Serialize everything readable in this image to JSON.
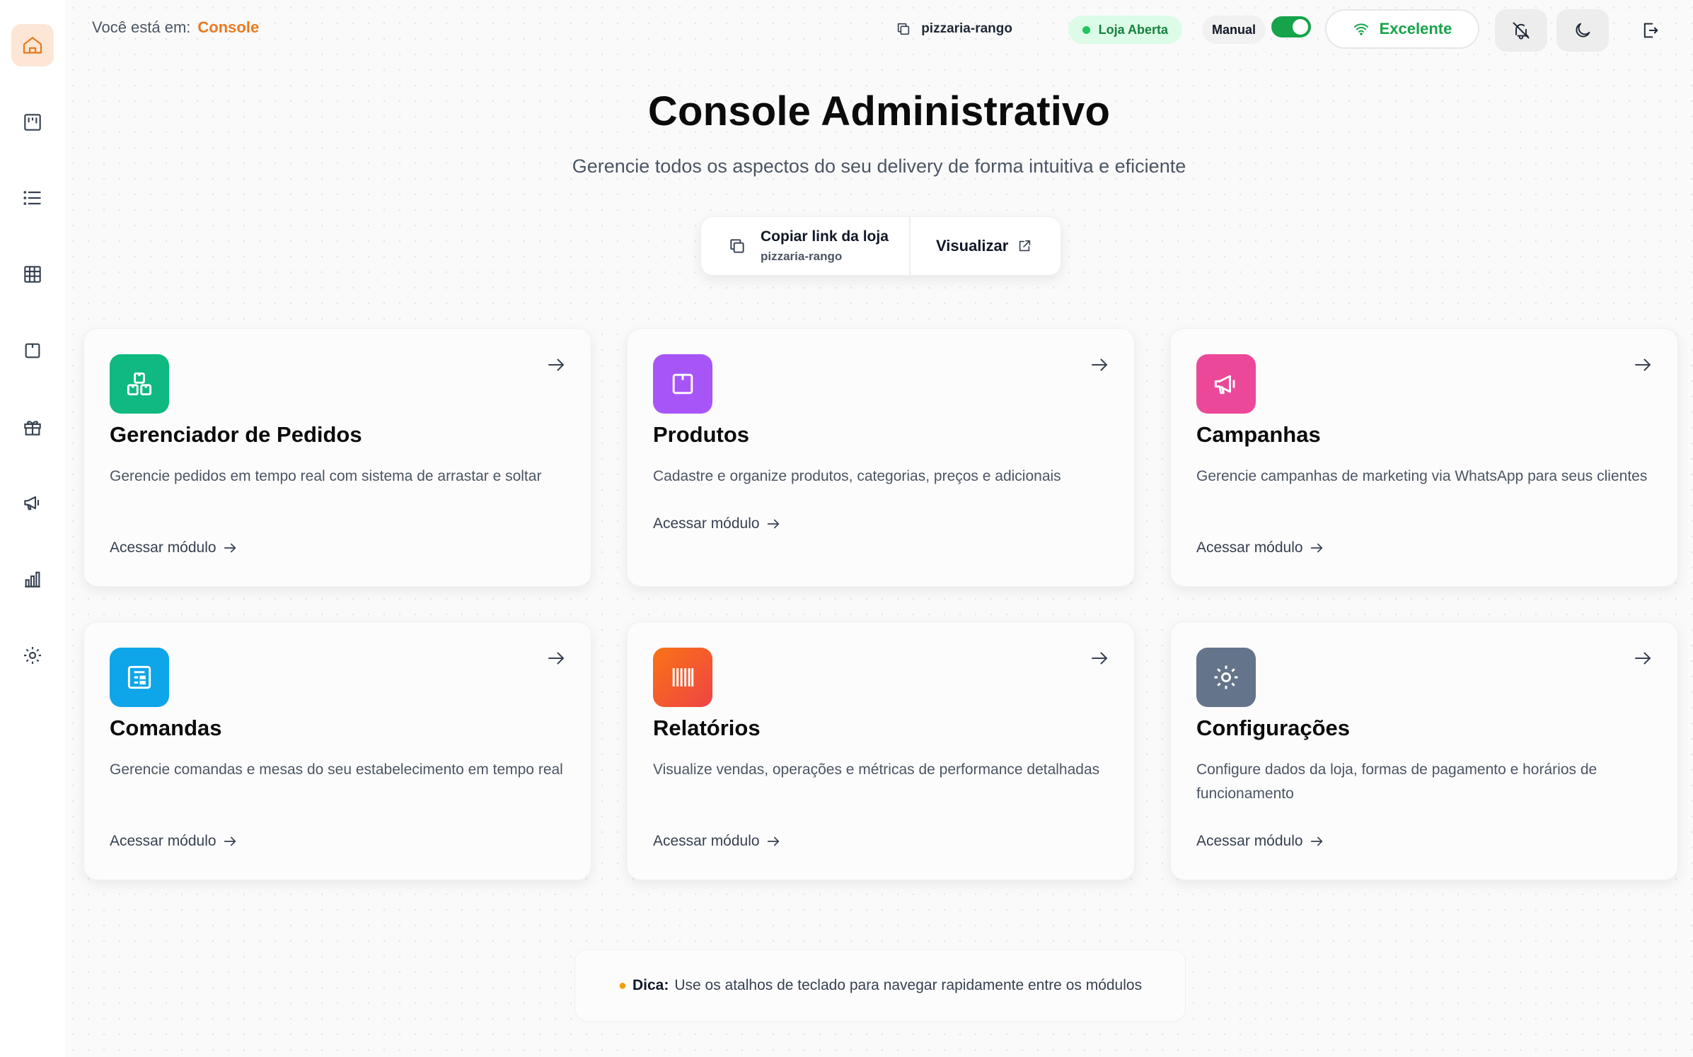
{
  "breadcrumb": {
    "prefix": "Você está em:",
    "current": "Console"
  },
  "topbar": {
    "store_slug": "pizzaria-rango",
    "status": "Loja Aberta",
    "mode": "Manual",
    "toggle_on": true,
    "connection": "Excelente"
  },
  "hero": {
    "title": "Console Administrativo",
    "subtitle": "Gerencie todos os aspectos do seu delivery de forma intuitiva e eficiente"
  },
  "copy_card": {
    "label": "Copiar link da loja",
    "slug": "pizzaria-rango",
    "view_label": "Visualizar"
  },
  "modules": [
    {
      "title": "Gerenciador de Pedidos",
      "description": "Gerencie pedidos em tempo real com sistema de arrastar e soltar",
      "link": "Acessar módulo",
      "color": "#10b981",
      "icon": "boxes-icon"
    },
    {
      "title": "Produtos",
      "description": "Cadastre e organize produtos, categorias, preços e adicionais",
      "link": "Acessar módulo",
      "color": "#a855f7",
      "icon": "package-icon"
    },
    {
      "title": "Campanhas",
      "description": "Gerencie campanhas de marketing via WhatsApp para seus clientes",
      "link": "Acessar módulo",
      "color": "#ec4899",
      "icon": "megaphone-icon"
    },
    {
      "title": "Comandas",
      "description": "Gerencie comandas e mesas do seu estabelecimento em tempo real",
      "link": "Acessar módulo",
      "color": "#0ea5e9",
      "icon": "receipt-icon"
    },
    {
      "title": "Relatórios",
      "description": "Visualize vendas, operações e métricas de performance detalhadas",
      "link": "Acessar módulo",
      "color": "#f97316",
      "icon": "barcode-icon"
    },
    {
      "title": "Configurações",
      "description": "Configure dados da loja, formas de pagamento e horários de funcionamento",
      "link": "Acessar módulo",
      "color": "#64748b",
      "icon": "gear-icon"
    }
  ],
  "tip": {
    "label": "Dica:",
    "text": "Use os atalhos de teclado para navegar rapidamente entre os módulos"
  },
  "sidebar_icons": [
    "home-icon",
    "kanban-icon",
    "list-icon",
    "table-grid-icon",
    "package-icon",
    "gift-icon",
    "megaphone-icon",
    "bar-chart-icon",
    "gear-icon"
  ],
  "colors": {
    "accent": "#ea7a1e",
    "success": "#16a34a"
  }
}
